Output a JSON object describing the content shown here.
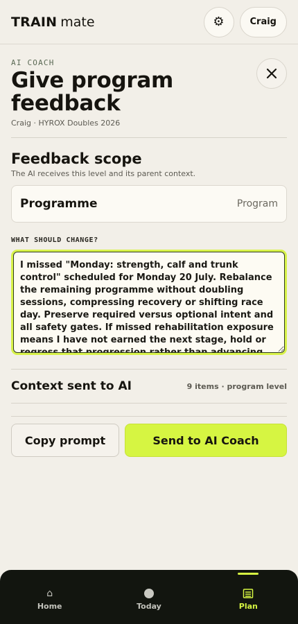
{
  "brand": {
    "bold": "TRAIN",
    "light": "mate"
  },
  "header": {
    "settings_icon": "gear-icon",
    "user_name": "Craig"
  },
  "page": {
    "eyebrow": "AI COACH",
    "title": "Give program feedback",
    "subtitle": "Craig · HYROX Doubles 2026",
    "close_icon": "close-icon"
  },
  "scope": {
    "title": "Feedback scope",
    "help": "The AI receives this level and its parent context.",
    "selected_name": "Programme",
    "selected_level": "Program"
  },
  "feedback": {
    "label": "WHAT SHOULD CHANGE?",
    "value": "I missed \"Monday: strength, calf and trunk control\" scheduled for Monday 20 July. Rebalance the remaining programme without doubling sessions, compressing recovery or shifting race day. Preserve required versus optional intent and all safety gates. If missed rehabilitation exposure means I have not earned the next stage, hold or regress that progression rather than advancing by calendar alone."
  },
  "context": {
    "title": "Context sent to AI",
    "meta": "9 items · program level"
  },
  "actions": {
    "copy_label": "Copy prompt",
    "send_label": "Send to AI Coach"
  },
  "nav": {
    "items": [
      {
        "label": "Home",
        "icon": "home-icon",
        "active": false
      },
      {
        "label": "Today",
        "icon": "today-dot-icon",
        "active": false
      },
      {
        "label": "Plan",
        "icon": "plan-icon",
        "active": true
      }
    ]
  },
  "colors": {
    "accent": "#d6f542",
    "background": "#f2efe8",
    "nav_background": "#12150f"
  }
}
